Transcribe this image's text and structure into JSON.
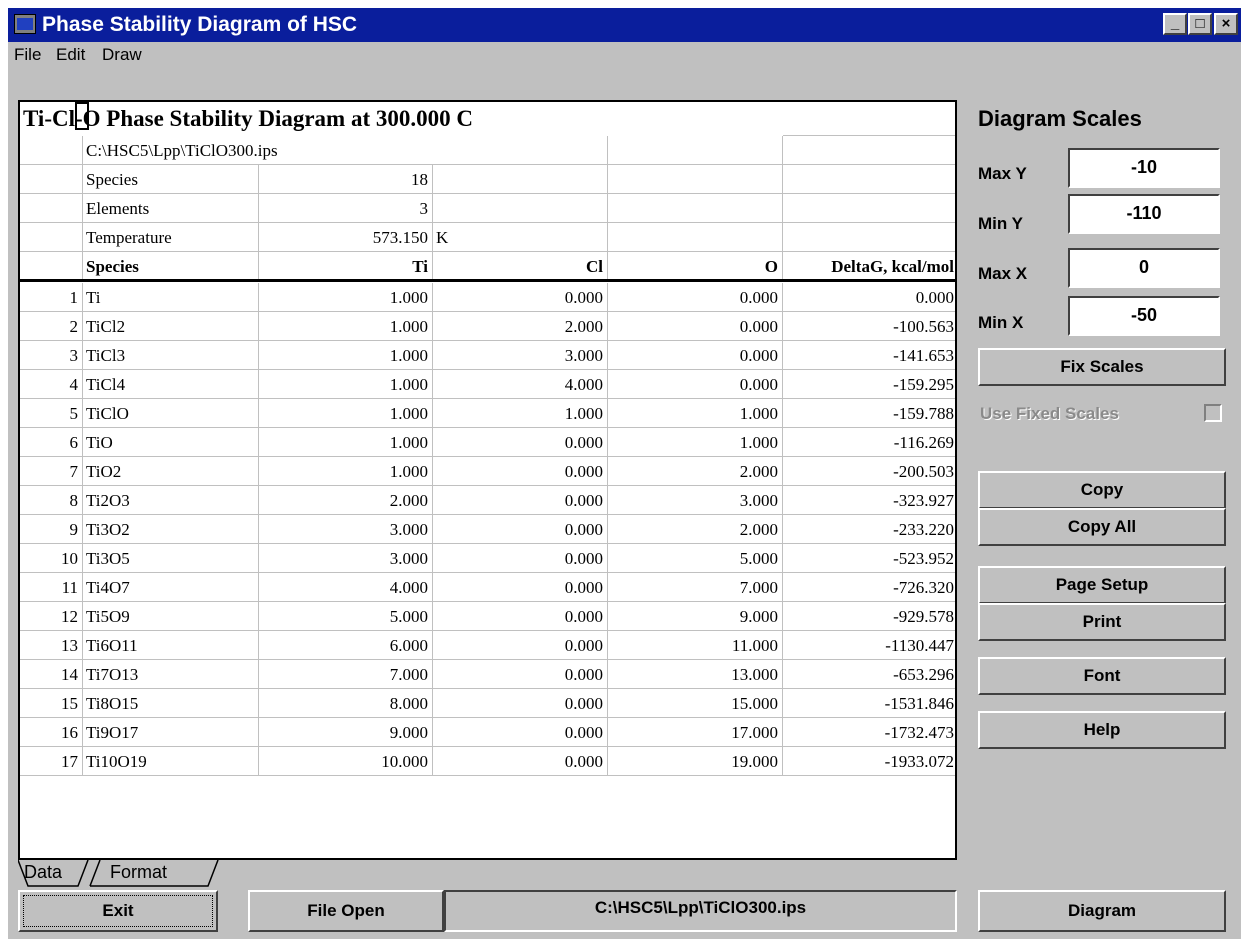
{
  "window": {
    "title": "Phase Stability Diagram of HSC",
    "controls": {
      "minimize": "_",
      "maximize": "□",
      "close": "×"
    }
  },
  "menu": [
    "File",
    "Edit",
    "Draw"
  ],
  "sheet": {
    "title": "Ti-Cl-O Phase Stability Diagram at  300.000 C",
    "info": [
      {
        "label": "C:\\HSC5\\Lpp\\TiClO300.ips",
        "value": "",
        "unit": ""
      },
      {
        "label": "Species",
        "value": "18",
        "unit": ""
      },
      {
        "label": "Elements",
        "value": "3",
        "unit": ""
      },
      {
        "label": "Temperature",
        "value": "573.150",
        "unit": "K"
      }
    ],
    "headers": [
      "Species",
      "Ti",
      "Cl",
      "O",
      "DeltaG, kcal/mol"
    ],
    "rows": [
      [
        "1",
        "Ti",
        "1.000",
        "0.000",
        "0.000",
        "0.000"
      ],
      [
        "2",
        "TiCl2",
        "1.000",
        "2.000",
        "0.000",
        "-100.563"
      ],
      [
        "3",
        "TiCl3",
        "1.000",
        "3.000",
        "0.000",
        "-141.653"
      ],
      [
        "4",
        "TiCl4",
        "1.000",
        "4.000",
        "0.000",
        "-159.295"
      ],
      [
        "5",
        "TiClO",
        "1.000",
        "1.000",
        "1.000",
        "-159.788"
      ],
      [
        "6",
        "TiO",
        "1.000",
        "0.000",
        "1.000",
        "-116.269"
      ],
      [
        "7",
        "TiO2",
        "1.000",
        "0.000",
        "2.000",
        "-200.503"
      ],
      [
        "8",
        "Ti2O3",
        "2.000",
        "0.000",
        "3.000",
        "-323.927"
      ],
      [
        "9",
        "Ti3O2",
        "3.000",
        "0.000",
        "2.000",
        "-233.220"
      ],
      [
        "10",
        "Ti3O5",
        "3.000",
        "0.000",
        "5.000",
        "-523.952"
      ],
      [
        "11",
        "Ti4O7",
        "4.000",
        "0.000",
        "7.000",
        "-726.320"
      ],
      [
        "12",
        "Ti5O9",
        "5.000",
        "0.000",
        "9.000",
        "-929.578"
      ],
      [
        "13",
        "Ti6O11",
        "6.000",
        "0.000",
        "11.000",
        "-1130.447"
      ],
      [
        "14",
        "Ti7O13",
        "7.000",
        "0.000",
        "13.000",
        "-653.296"
      ],
      [
        "15",
        "Ti8O15",
        "8.000",
        "0.000",
        "15.000",
        "-1531.846"
      ],
      [
        "16",
        "Ti9O17",
        "9.000",
        "0.000",
        "17.000",
        "-1732.473"
      ],
      [
        "17",
        "Ti10O19",
        "10.000",
        "0.000",
        "19.000",
        "-1933.072"
      ]
    ],
    "tabs": [
      "Data",
      "Format"
    ]
  },
  "scales": {
    "heading": "Diagram Scales",
    "max_y_label": "Max Y",
    "max_y": "-10",
    "min_y_label": "Min Y",
    "min_y": "-110",
    "max_x_label": "Max X",
    "max_x": "0",
    "min_x_label": "Min X",
    "min_x": "-50",
    "fix_scales": "Fix Scales",
    "use_fixed": "Use Fixed Scales",
    "use_fixed_checked": false
  },
  "buttons": {
    "copy": "Copy",
    "copy_all": "Copy All",
    "page_setup": "Page Setup",
    "print": "Print",
    "font": "Font",
    "help": "Help",
    "exit": "Exit",
    "file_open": "File Open",
    "diagram": "Diagram"
  },
  "status": {
    "file_path": "C:\\HSC5\\Lpp\\TiClO300.ips"
  }
}
